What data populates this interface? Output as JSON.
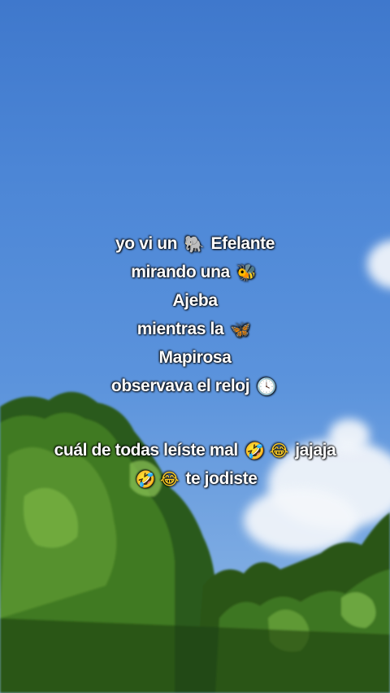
{
  "caption": {
    "line1": {
      "before": "yo vi un",
      "emoji": "🐘",
      "emoji_name": "elephant-icon",
      "after": "Efelante"
    },
    "line2": {
      "before": "mirando una",
      "emoji": "🐝",
      "emoji_name": "bee-icon"
    },
    "line3": {
      "text": "Ajeba"
    },
    "line4": {
      "before": "mientras la",
      "emoji": "🦋",
      "emoji_name": "butterfly-icon"
    },
    "line5": {
      "text": "Mapirosa"
    },
    "line6": {
      "before": "observava el reloj",
      "emoji": "🕓",
      "emoji_name": "clock-icon"
    },
    "line7": {
      "before": "cuál de todas leíste mal",
      "emoji1": "🤣",
      "emoji2": "😂",
      "after": "jajaja"
    },
    "line8": {
      "emoji1": "🤣",
      "emoji2": "😂",
      "after": "te jodiste"
    }
  },
  "colors": {
    "sky": "#4f86d4",
    "text": "#ffffff",
    "foliage": "#2f5a1c"
  }
}
